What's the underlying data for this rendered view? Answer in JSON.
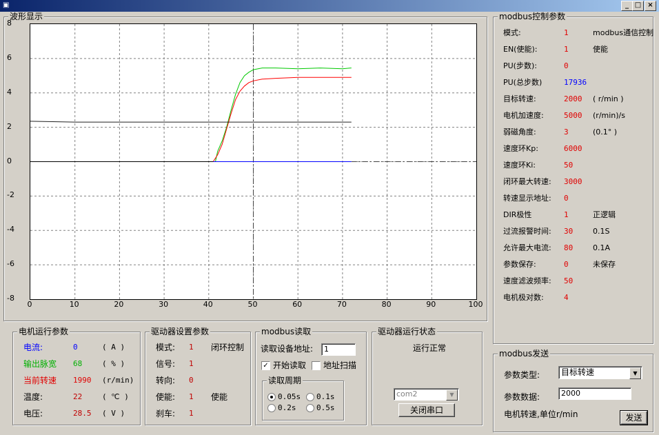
{
  "window": {
    "min": "_",
    "max": "□",
    "close": "×"
  },
  "chart_panel": {
    "title": "波形显示",
    "chart_data": {
      "type": "line",
      "xlim": [
        0,
        100
      ],
      "ylim": [
        -8,
        8
      ],
      "x_ticks": [
        "0",
        "10",
        "20",
        "30",
        "40",
        "50",
        "60",
        "70",
        "80",
        "90",
        "100"
      ],
      "y_ticks": [
        "8",
        "6",
        "4",
        "2",
        "0",
        "-2",
        "-4",
        "-6",
        "-8"
      ],
      "grid": true,
      "cursor_x": 50,
      "series": [
        {
          "color": "#00c800",
          "x": [
            41.5,
            42,
            43,
            44,
            45,
            46,
            47,
            48,
            49,
            50,
            52,
            55,
            60,
            65,
            70,
            72
          ],
          "y": [
            0,
            0.6,
            1.2,
            2.0,
            3.0,
            3.9,
            4.6,
            5.0,
            5.2,
            5.35,
            5.45,
            5.45,
            5.4,
            5.45,
            5.4,
            5.45
          ]
        },
        {
          "color": "#ff0000",
          "x": [
            41,
            42,
            43,
            44,
            45,
            46,
            47,
            48,
            49,
            50,
            52,
            55,
            60,
            65,
            70,
            72
          ],
          "y": [
            0,
            0.4,
            1.0,
            1.9,
            2.8,
            3.6,
            4.1,
            4.4,
            4.6,
            4.7,
            4.8,
            4.85,
            4.9,
            4.9,
            4.9,
            4.9
          ]
        },
        {
          "color": "#202020",
          "x": [
            0,
            10,
            20,
            30,
            40,
            50,
            60,
            72
          ],
          "y": [
            2.35,
            2.3,
            2.3,
            2.3,
            2.3,
            2.3,
            2.3,
            2.3
          ]
        },
        {
          "color": "#0000ff",
          "x": [
            41,
            72
          ],
          "y": [
            0,
            0
          ]
        },
        {
          "color": "#000000",
          "x": [
            0,
            41
          ],
          "y": [
            0,
            0
          ]
        }
      ]
    }
  },
  "motor": {
    "title": "电机运行参数",
    "rows": [
      {
        "label": "电流:",
        "value": "0",
        "unit": "( A )",
        "color": "blue"
      },
      {
        "label": "输出脉宽",
        "value": "68",
        "unit": "( % )",
        "color": "green"
      },
      {
        "label": "当前转速",
        "value": "1990",
        "unit": "(r/min)",
        "color": "red"
      },
      {
        "label": "温度:",
        "value": "22",
        "unit": "( ℃ )",
        "color": "black"
      },
      {
        "label": "电压:",
        "value": "28.5",
        "unit": "( V )",
        "color": "black"
      }
    ]
  },
  "driver": {
    "title": "驱动器设置参数",
    "rows": [
      {
        "label": "模式:",
        "value": "1",
        "note": "闭环控制"
      },
      {
        "label": "信号:",
        "value": "1",
        "note": ""
      },
      {
        "label": "转向:",
        "value": "0",
        "note": ""
      },
      {
        "label": "使能:",
        "value": "1",
        "note": "使能"
      },
      {
        "label": "刹车:",
        "value": "1",
        "note": ""
      }
    ]
  },
  "modbus_read": {
    "title": "modbus读取",
    "addr_label": "读取设备地址:",
    "addr_value": "1",
    "start_label": "开始读取",
    "start_checked": "✓",
    "scan_label": "地址扫描",
    "period_title": "读取周期",
    "periods": [
      "0.05s",
      "0.1s",
      "0.2s",
      "0.5s"
    ]
  },
  "status": {
    "title": "驱动器运行状态",
    "text": "运行正常",
    "port": "com2",
    "close_port": "关闭串口",
    "arrow": "▼"
  },
  "control": {
    "title": "modbus控制参数",
    "rows": [
      {
        "label": "模式:",
        "value": "1",
        "note": "modbus通信控制",
        "color": "red"
      },
      {
        "label": "EN(使能):",
        "value": "1",
        "note": "使能",
        "color": "red"
      },
      {
        "label": "PU(步数):",
        "value": "0",
        "note": "",
        "color": "red"
      },
      {
        "label": "PU(总步数)",
        "value": "17936",
        "note": "",
        "color": "blue"
      },
      {
        "label": "目标转速:",
        "value": "2000",
        "note": "( r/min )",
        "color": "red"
      },
      {
        "label": "电机加速度:",
        "value": "5000",
        "note": "(r/min)/s",
        "color": "red"
      },
      {
        "label": "弱磁角度:",
        "value": "3",
        "note": "(0.1° )",
        "color": "red"
      },
      {
        "label": "速度环Kp:",
        "value": "6000",
        "note": "",
        "color": "red"
      },
      {
        "label": "速度环Ki:",
        "value": "50",
        "note": "",
        "color": "red"
      },
      {
        "label": "闭环最大转速:",
        "value": "3000",
        "note": "",
        "color": "red"
      },
      {
        "label": "转速显示地址:",
        "value": "0",
        "note": "",
        "color": "red"
      },
      {
        "label": "DIR极性",
        "value": "1",
        "note": "正逻辑",
        "color": "red"
      },
      {
        "label": "过流报警时间:",
        "value": "30",
        "note": "0.1S",
        "color": "red"
      },
      {
        "label": "允许最大电流:",
        "value": "80",
        "note": "0.1A",
        "color": "red"
      },
      {
        "label": "参数保存:",
        "value": "0",
        "note": "未保存",
        "color": "red"
      },
      {
        "label": "速度滤波频率:",
        "value": "50",
        "note": "",
        "color": "red"
      },
      {
        "label": "电机极对数:",
        "value": "4",
        "note": "",
        "color": "red"
      }
    ]
  },
  "send": {
    "title": "modbus发送",
    "type_label": "参数类型:",
    "type_value": "目标转速",
    "data_label": "参数数据:",
    "data_value": "2000",
    "hint": "电机转速,单位r/min",
    "send_button": "发送",
    "arrow": "▼"
  }
}
